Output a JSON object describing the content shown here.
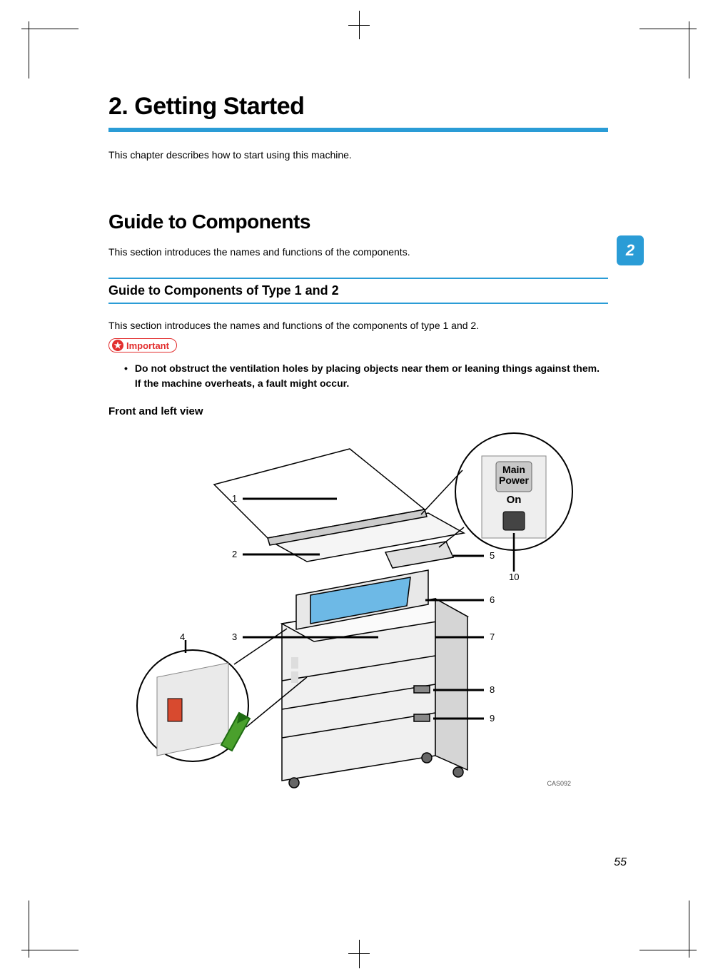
{
  "chapter": {
    "title": "2. Getting Started",
    "intro": "This chapter describes how to start using this machine."
  },
  "section": {
    "title": "Guide to Components",
    "intro": "This section introduces the names and functions of the components."
  },
  "subsection": {
    "title": "Guide to Components of Type 1 and 2",
    "intro": "This section introduces the names and functions of the components of type 1 and 2.",
    "important_label": "Important",
    "important_bullet": "Do not obstruct the ventilation holes by placing objects near them or leaning things against them. If the machine overheats, a fault might occur.",
    "view_label": "Front and left view"
  },
  "figure": {
    "callouts": [
      "1",
      "2",
      "3",
      "4",
      "5",
      "6",
      "7",
      "8",
      "9",
      "10"
    ],
    "image_code": "CAS092",
    "inset_main_power": "Main\nPower",
    "inset_on": "On"
  },
  "page": {
    "section_number": "2",
    "page_number": "55"
  }
}
